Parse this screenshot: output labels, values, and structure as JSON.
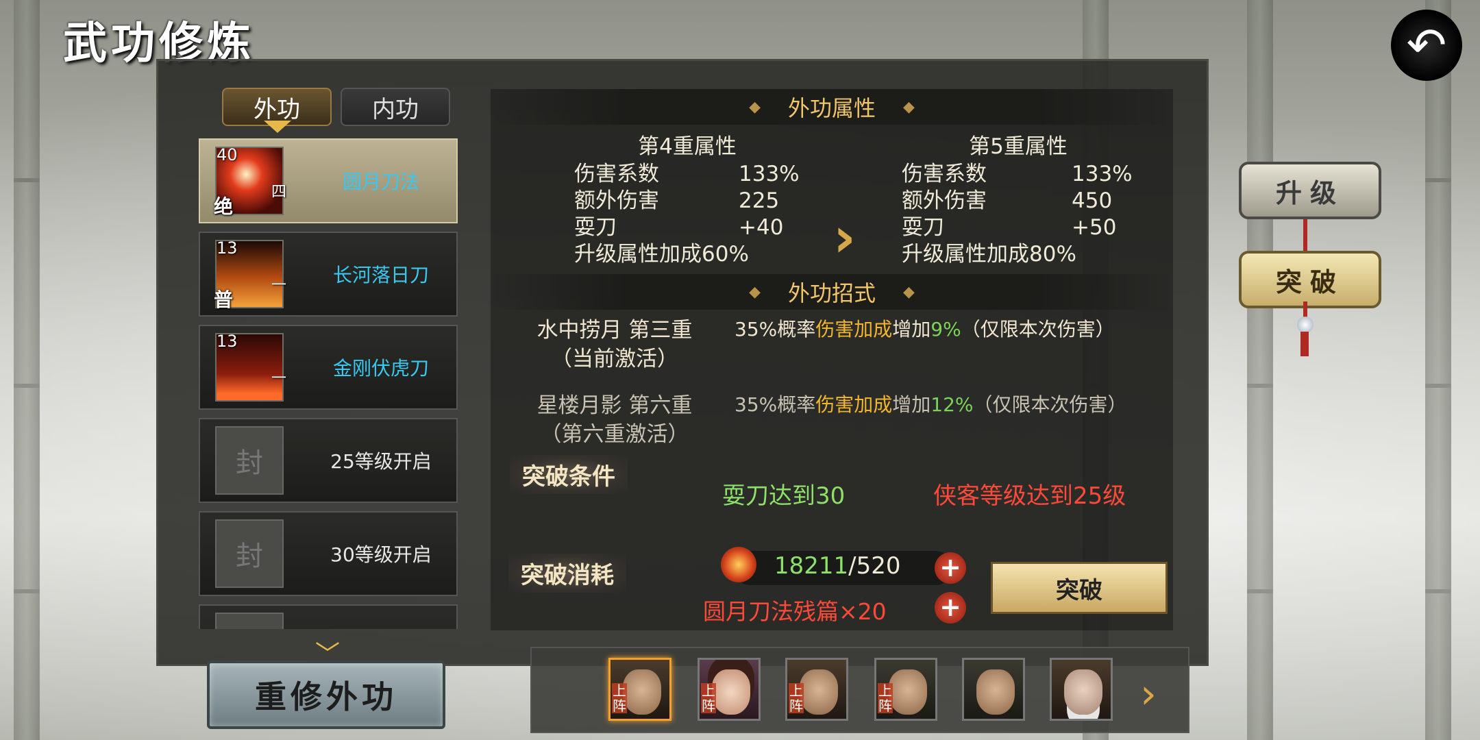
{
  "title": "武功修炼",
  "tabs": {
    "outer": "外功",
    "inner": "内功"
  },
  "skills": [
    {
      "level": "40",
      "grade": "绝",
      "rank": "四",
      "name": "圆月刀法",
      "icon": "red-slash"
    },
    {
      "level": "13",
      "grade": "普",
      "rank": "一",
      "name": "长河落日刀",
      "icon": "fire-figure"
    },
    {
      "level": "13",
      "grade": "",
      "rank": "一",
      "name": "金刚伏虎刀",
      "icon": "embers"
    },
    {
      "level": "",
      "grade": "",
      "rank": "",
      "name": "25等级开启",
      "icon": "locked-seal",
      "lock_glyph": "封"
    },
    {
      "level": "",
      "grade": "",
      "rank": "",
      "name": "30等级开启",
      "icon": "locked-seal",
      "lock_glyph": "封"
    }
  ],
  "reset_button": "重修外功",
  "attributes": {
    "header": "外功属性",
    "current": {
      "title": "第4重属性",
      "rows": [
        {
          "label": "伤害系数",
          "value": "133%"
        },
        {
          "label": "额外伤害",
          "value": "225"
        },
        {
          "label": "耍刀",
          "value": "+40"
        },
        {
          "label": "升级属性加成",
          "value": "60%"
        }
      ]
    },
    "next": {
      "title": "第5重属性",
      "rows": [
        {
          "label": "伤害系数",
          "value": "133%"
        },
        {
          "label": "额外伤害",
          "value": "450"
        },
        {
          "label": "耍刀",
          "value": "+50"
        },
        {
          "label": "升级属性加成",
          "value": "80%"
        }
      ]
    }
  },
  "moves": {
    "header": "外功招式",
    "list": [
      {
        "name1": "水中捞月 第三重",
        "name2": "（当前激活）",
        "desc_pre": "35%概率",
        "desc_hl": "伤害加成",
        "desc_mid": "增加",
        "desc_num": "9%",
        "desc_post": "（仅限本次伤害）"
      },
      {
        "name1": "星楼月影 第六重",
        "name2": "（第六重激活）",
        "desc_pre": "35%概率",
        "desc_hl": "伤害加成",
        "desc_mid": "增加",
        "desc_num": "12%",
        "desc_post": "（仅限本次伤害）"
      }
    ]
  },
  "conditions": {
    "label": "突破条件",
    "ok": "耍刀达到30",
    "unmet": "侠客等级达到25级"
  },
  "cost": {
    "label": "突破消耗",
    "have": "18211",
    "need": "/520",
    "fragment": "圆月刀法残篇×20"
  },
  "break_button": "突破",
  "side_buttons": {
    "upgrade": "升级",
    "breakthrough": "突破"
  },
  "heroes": {
    "deploy_tag": "上阵"
  },
  "colors": {
    "accent": "#f2c66a",
    "ok": "#8ee06a",
    "bad": "#ff4a3a",
    "skill_name": "#39c8f0"
  }
}
